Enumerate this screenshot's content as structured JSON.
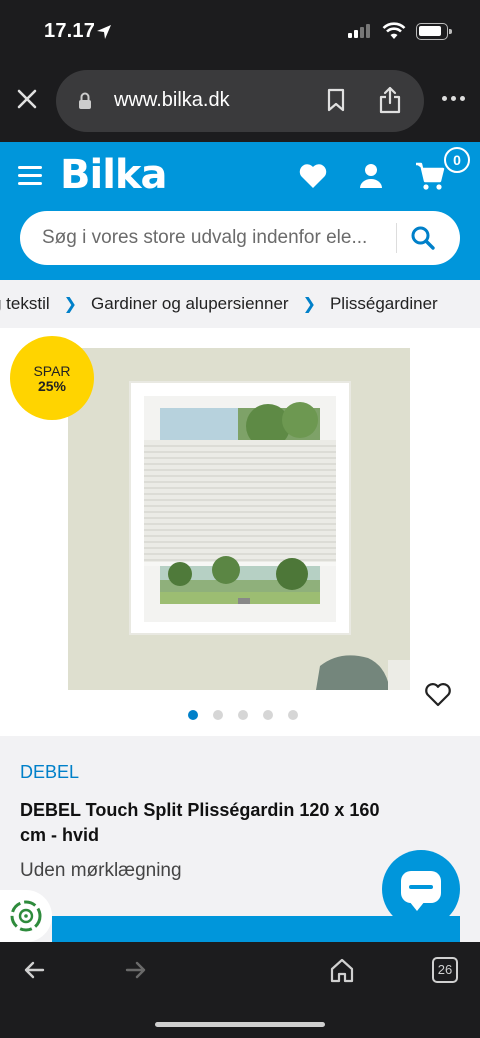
{
  "status_bar": {
    "time": "17.17"
  },
  "browser": {
    "url": "www.bilka.dk",
    "open_tabs": "26"
  },
  "header": {
    "logo": "Bilka",
    "cart_count": "0",
    "search_placeholder": "Søg i vores store udvalg indenfor ele..."
  },
  "breadcrumb": {
    "items": [
      "g tekstil",
      "Gardiner og alupersienner",
      "Plisségardiner"
    ]
  },
  "gallery": {
    "badge_line1": "SPAR",
    "badge_line2": "25%",
    "image_count": 5,
    "active_index": 0
  },
  "product": {
    "brand": "DEBEL",
    "title": "DEBEL Touch Split Plisségardin 120 x 160 cm - hvid",
    "variant": "Uden mørklægning"
  },
  "colors": {
    "brand_blue": "#0096db",
    "link_blue": "#0080c9",
    "badge_yellow": "#ffd400",
    "chrome_dark": "#1c1c1e"
  }
}
